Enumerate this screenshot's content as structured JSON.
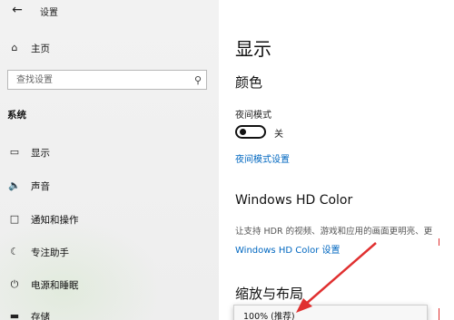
{
  "window": {
    "title": "设置"
  },
  "sidebar": {
    "home_label": "主页",
    "search_placeholder": "查找设置",
    "section_title": "系统",
    "items": [
      {
        "label": "显示",
        "icon": "monitor-icon"
      },
      {
        "label": "声音",
        "icon": "speaker-icon"
      },
      {
        "label": "通知和操作",
        "icon": "notification-icon"
      },
      {
        "label": "专注助手",
        "icon": "moon-icon"
      },
      {
        "label": "电源和睡眠",
        "icon": "power-icon"
      },
      {
        "label": "存储",
        "icon": "storage-icon"
      }
    ]
  },
  "main": {
    "page_title": "显示",
    "color_heading": "颜色",
    "night_mode_label": "夜间模式",
    "night_mode_state": "关",
    "night_mode_settings_link": "夜间模式设置",
    "hdr_heading": "Windows HD Color",
    "hdr_description": "让支持 HDR 的视频、游戏和应用的画面更明亮、更",
    "hdr_settings_link": "Windows HD Color 设置",
    "scale_heading": "缩放与布局",
    "scale_value": "100% (推荐)"
  },
  "colors": {
    "accent": "#0067c0",
    "annotation_arrow": "#e03030"
  }
}
